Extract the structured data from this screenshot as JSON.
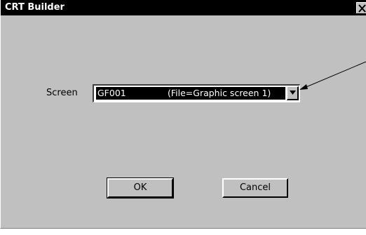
{
  "window": {
    "title": "CRT Builder",
    "close_glyph": "✕"
  },
  "form": {
    "screen_label": "Screen",
    "screen_select": {
      "code": "GF001",
      "description": "(File=Graphic screen 1)",
      "arrow_icon": "chevron-down-icon"
    }
  },
  "buttons": {
    "ok_label": "OK",
    "cancel_label": "Cancel"
  },
  "colors": {
    "dialog_face": "#c0c0c0",
    "title_bar": "#000000",
    "selection": "#000000"
  }
}
